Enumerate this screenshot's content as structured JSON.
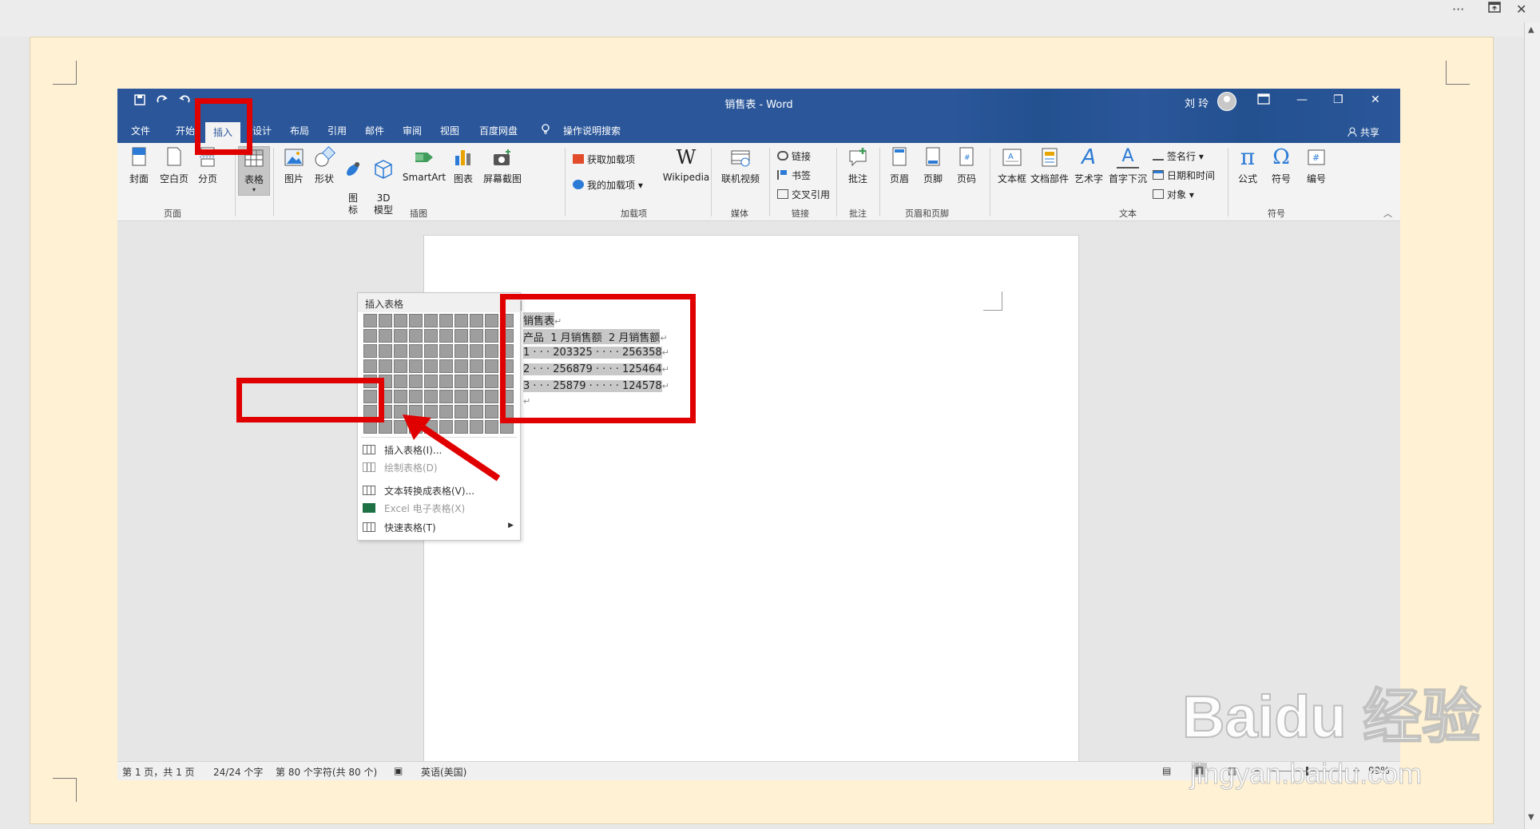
{
  "outer": {
    "ellipsis": "···",
    "restore_icon": "restore-icon",
    "close_glyph": "✕"
  },
  "word": {
    "title": "销售表 - Word",
    "user_name": "刘 玲",
    "share": "共享",
    "tabs": [
      "文件",
      "开始",
      "插入",
      "设计",
      "布局",
      "引用",
      "邮件",
      "审阅",
      "视图",
      "百度网盘",
      "操作说明搜索"
    ],
    "active_tab": "插入",
    "ribbon": {
      "pages": {
        "cover": "封面",
        "blank": "空白页",
        "break": "分页",
        "label": "页面"
      },
      "table": {
        "label": "表格"
      },
      "illustrations": {
        "picture": "图片",
        "shapes": "形状",
        "icons": "图\n标",
        "model3d": "3D\n模型",
        "smartart": "SmartArt",
        "chart": "图表",
        "screenshot": "屏幕截图",
        "label": "插图"
      },
      "addins": {
        "get": "获取加载项",
        "mine": "我的加载项",
        "wikipedia": "Wikipedia",
        "label": "加载项"
      },
      "media": {
        "video": "联机视频",
        "label": "媒体"
      },
      "links": {
        "link": "链接",
        "bookmark": "书签",
        "crossref": "交叉引用",
        "label": "链接"
      },
      "comments": {
        "comment": "批注",
        "label": "批注"
      },
      "headerfooter": {
        "header": "页眉",
        "footer": "页脚",
        "pagenum": "页码",
        "label": "页眉和页脚"
      },
      "text": {
        "textbox": "文本框",
        "parts": "文档部件",
        "wordart": "艺术字",
        "dropcap": "首字下沉",
        "signature": "签名行",
        "datetime": "日期和时间",
        "object": "对象",
        "label": "文本"
      },
      "symbols": {
        "equation": "公式",
        "symbol": "符号",
        "number": "编号",
        "label": "符号"
      }
    },
    "dropdown": {
      "header": "插入表格",
      "items": [
        "插入表格(I)...",
        "绘制表格(D)",
        "文本转换成表格(V)...",
        "Excel 电子表格(X)",
        "快速表格(T)"
      ]
    },
    "document": {
      "lines": [
        "销售表",
        "产品  1 月销售额  2 月销售额",
        "1 · · · 203325 · · · · 256358",
        "2 · · · 256879 · · · · 125464",
        "3 · · · 25879 · · · · · 124578"
      ]
    },
    "status": {
      "page": "第 1 页，共 1 页",
      "words": "24/24 个字",
      "chars": "第 80 个字符(共 80 个)",
      "language": "英语(美国)",
      "zoom": "99%"
    }
  },
  "watermark": {
    "brand": "Baidu 经验",
    "url": "jingyan.baidu.com"
  },
  "colors": {
    "word_blue": "#2b579a",
    "highlight_red": "#e00000",
    "paper": "#fff1d3"
  }
}
